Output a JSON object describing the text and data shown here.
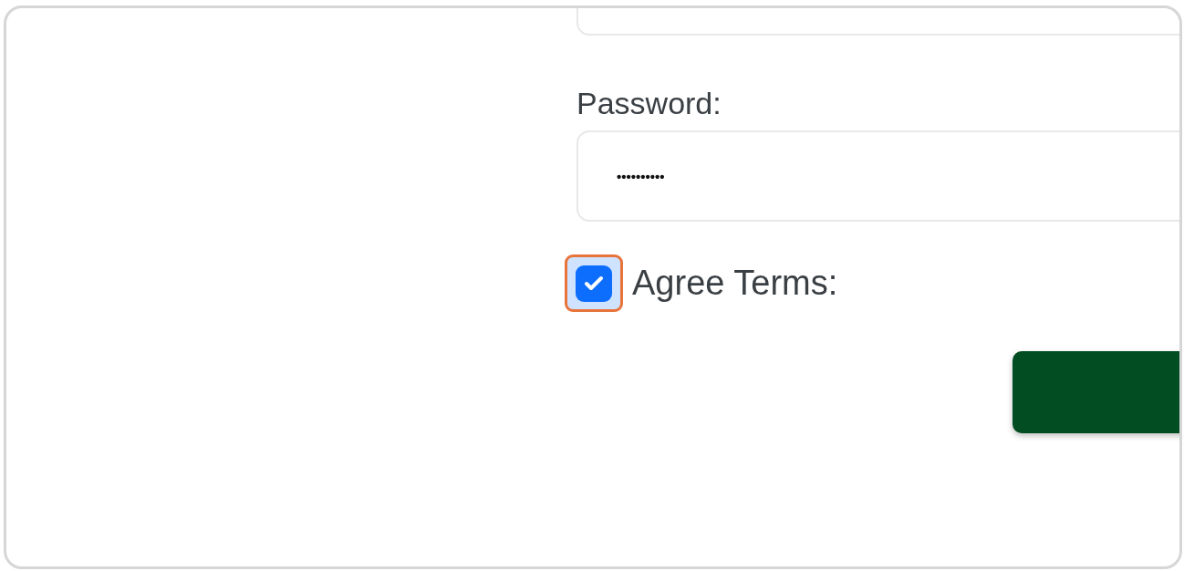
{
  "fields": [
    {
      "kind": "cut"
    },
    {
      "kind": "password",
      "label": "Password:",
      "value": "••••••••••"
    }
  ],
  "agree": {
    "label": "Agree Terms:",
    "checked": true,
    "focused": true
  }
}
